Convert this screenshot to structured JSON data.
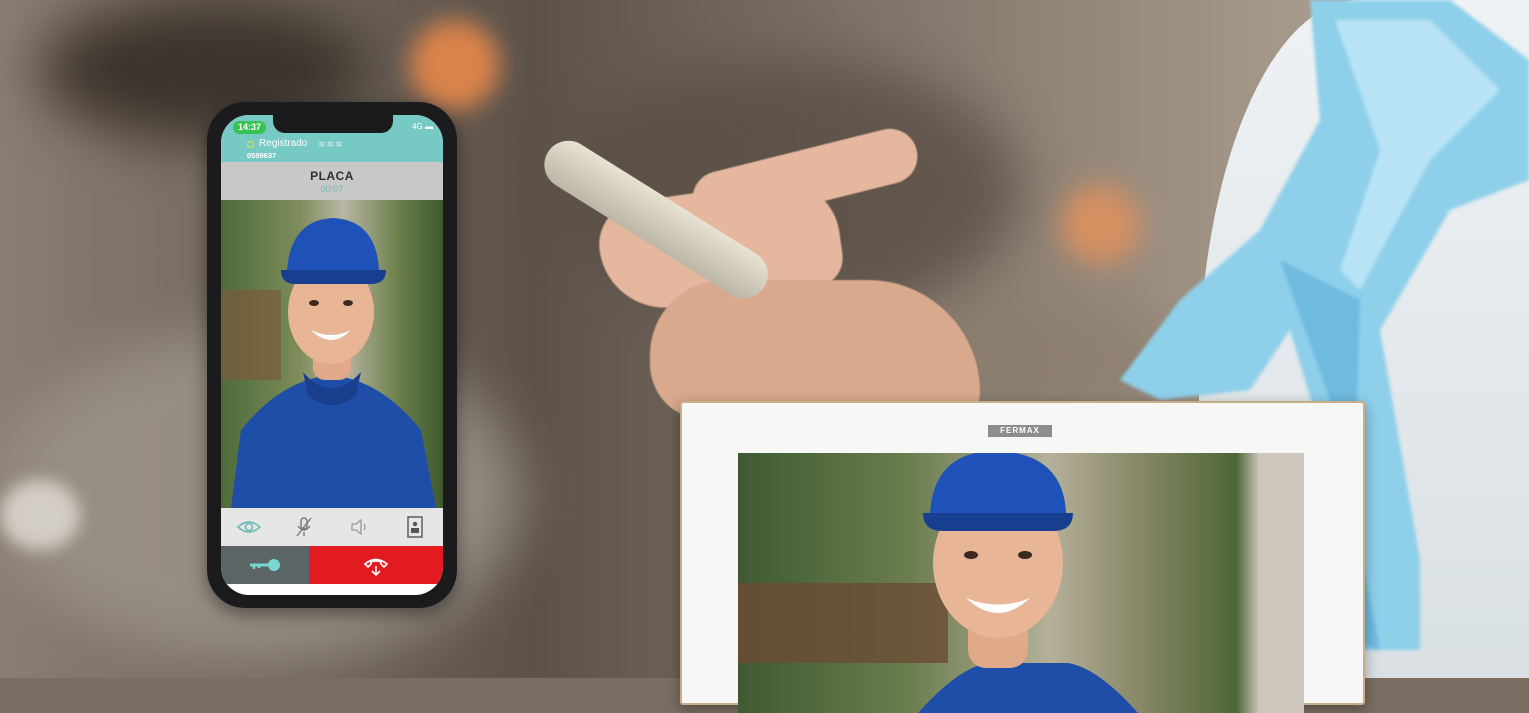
{
  "phone": {
    "status_time": "14:37",
    "network": "4G",
    "registration_status": "Registrado",
    "device_number": "0599637",
    "call_title": "PLACA",
    "call_timer": "00:07",
    "controls": [
      "eye-icon",
      "mic-muted-icon",
      "speaker-icon",
      "door-panel-icon"
    ],
    "actions": [
      "key-icon",
      "hang-up-icon"
    ],
    "colors": {
      "appbar": "#77c9c3",
      "hangup": "#e11b1f",
      "key": "#5b6566",
      "timer": "#6fb9b4"
    }
  },
  "monitor": {
    "brand": "FERMAX"
  }
}
